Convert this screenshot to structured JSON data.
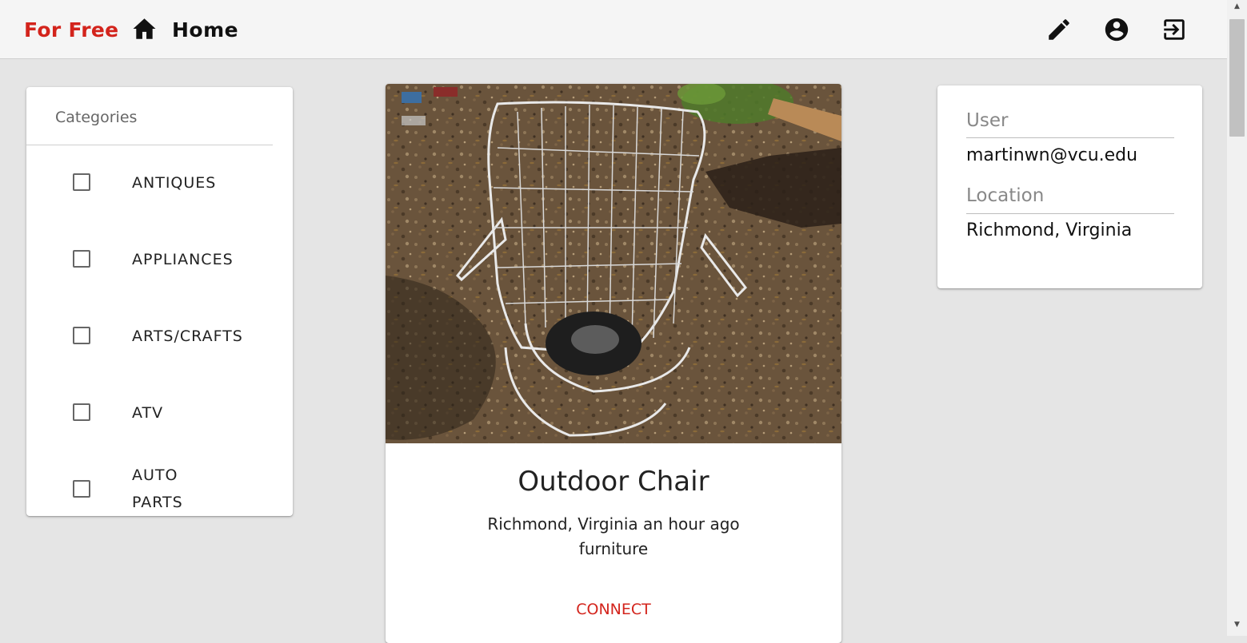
{
  "header": {
    "brand": "For Free",
    "home_label": "Home",
    "icons": [
      "home-icon",
      "edit-icon",
      "account-circle-icon",
      "exit-icon"
    ]
  },
  "colors": {
    "brand_red": "#d3241c",
    "background": "#e5e5e5",
    "appbar": "#f5f5f5"
  },
  "categories": {
    "title": "Categories",
    "items": [
      {
        "label": "ANTIQUES",
        "checked": false
      },
      {
        "label": "APPLIANCES",
        "checked": false
      },
      {
        "label": "ARTS/CRAFTS",
        "checked": false
      },
      {
        "label": "ATV",
        "checked": false
      },
      {
        "label": "AUTO PARTS",
        "checked": false
      }
    ]
  },
  "post": {
    "title": "Outdoor Chair",
    "location_time": "Richmond, Virginia an hour ago",
    "category": "furniture",
    "action": "CONNECT"
  },
  "profile": {
    "user_label": "User",
    "user_value": "martinwn@vcu.edu",
    "location_label": "Location",
    "location_value": "Richmond, Virginia"
  }
}
